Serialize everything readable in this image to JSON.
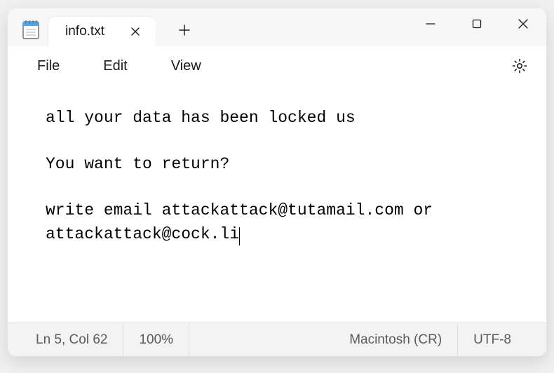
{
  "tab": {
    "title": "info.txt"
  },
  "menu": {
    "file": "File",
    "edit": "Edit",
    "view": "View"
  },
  "content": {
    "line1": "all your data has been locked us",
    "line2": "You want to return?",
    "line3": "write email attackattack@tutamail.com or attackattack@cock.li"
  },
  "status": {
    "pos": "Ln 5, Col 62",
    "zoom": "100%",
    "eol": "Macintosh (CR)",
    "encoding": "UTF-8"
  },
  "icons": {
    "app": "notepad-icon",
    "close": "close-icon",
    "plus": "plus-icon",
    "min": "minimize-icon",
    "max": "maximize-icon",
    "x": "window-close-icon",
    "gear": "gear-icon"
  }
}
